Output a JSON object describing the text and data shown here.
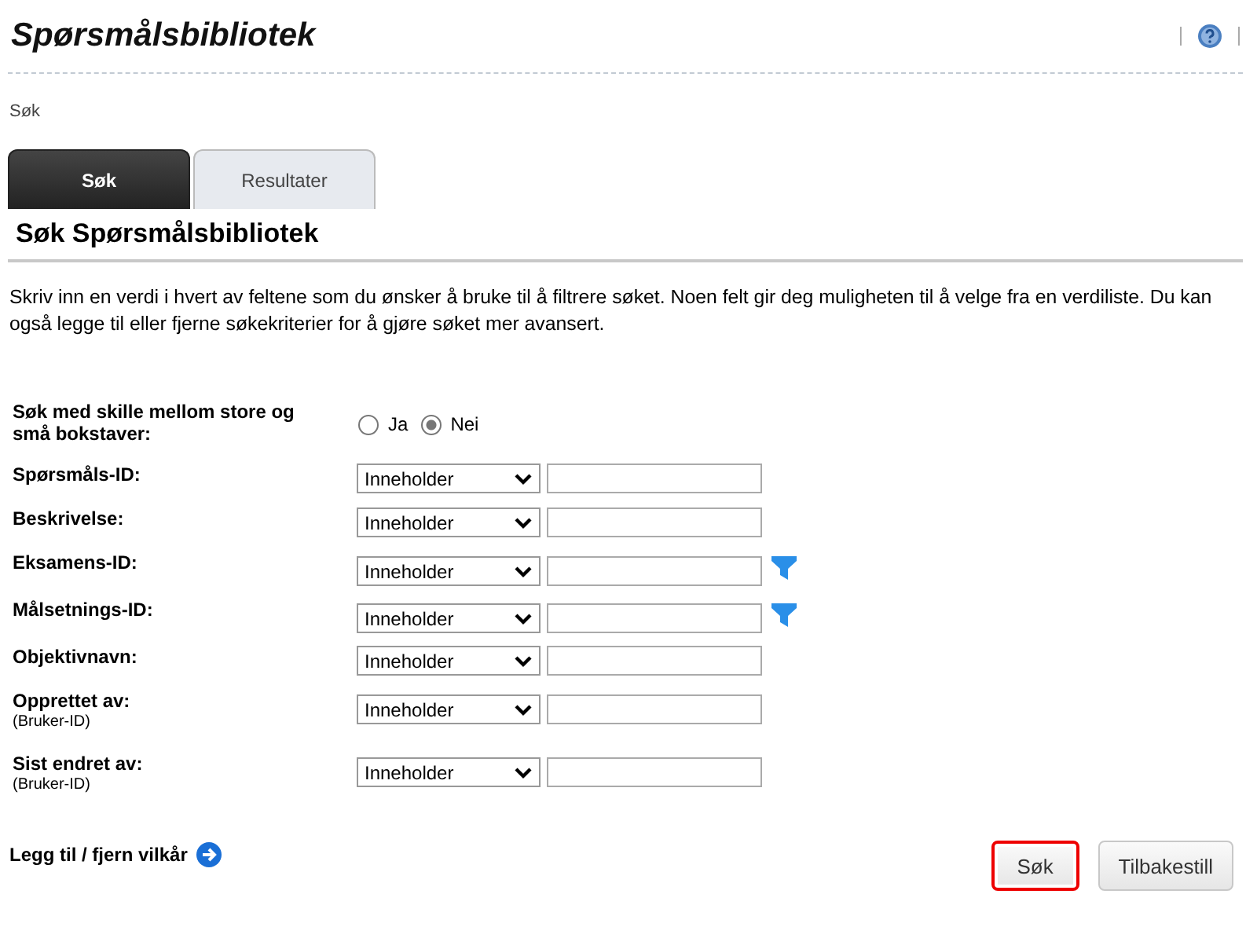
{
  "page_title": "Spørsmålsbibliotek",
  "breadcrumb": "Søk",
  "tabs": [
    {
      "label": "Søk",
      "selected": true
    },
    {
      "label": "Resultater",
      "selected": false
    }
  ],
  "section_title": "Søk Spørsmålsbibliotek",
  "intro": "Skriv inn en verdi i hvert av feltene som du ønsker å bruke til å filtrere søket. Noen felt gir deg muligheten til å velge fra en verdiliste. Du kan også legge til eller fjerne søkekriterier for å gjøre søket mer avansert.",
  "case_option": {
    "label": "Søk med skille mellom store og små bokstaver:",
    "choices": [
      {
        "label": "Ja",
        "selected": false
      },
      {
        "label": "Nei",
        "selected": true
      }
    ]
  },
  "fields": [
    {
      "label": "Spørsmåls-ID:",
      "operator": "Inneholder",
      "filter": false
    },
    {
      "label": "Beskrivelse:",
      "operator": "Inneholder",
      "filter": false
    },
    {
      "label": "Eksamens-ID:",
      "operator": "Inneholder",
      "filter": true
    },
    {
      "label": "Målsetnings-ID:",
      "operator": "Inneholder",
      "filter": true
    },
    {
      "label": "Objektivnavn:",
      "operator": "Inneholder",
      "filter": false
    },
    {
      "label": "Opprettet av:",
      "sublabel": "(Bruker-ID)",
      "operator": "Inneholder",
      "filter": false
    },
    {
      "label": "Sist endret av:",
      "sublabel": "(Bruker-ID)",
      "operator": "Inneholder",
      "filter": false
    }
  ],
  "add_criteria_link": "Legg til / fjern vilkår",
  "buttons": [
    {
      "label": "Søk",
      "highlighted": true
    },
    {
      "label": "Tilbakestill",
      "highlighted": false
    }
  ]
}
